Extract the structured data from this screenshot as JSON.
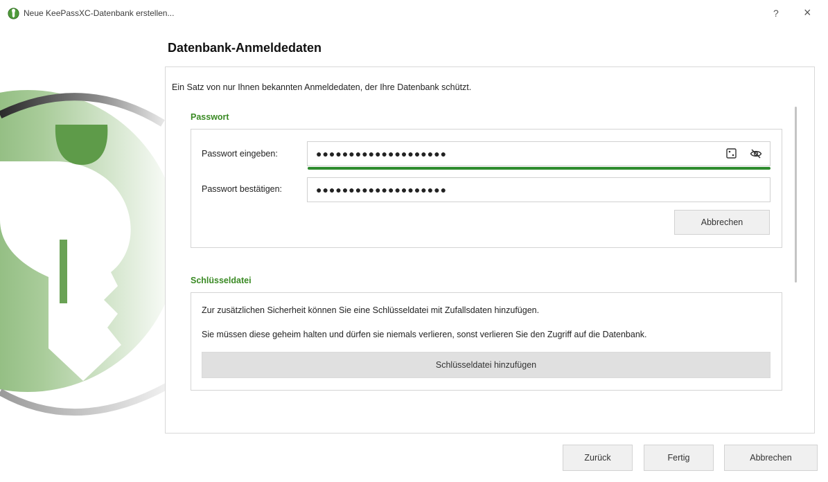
{
  "window": {
    "title": "Neue KeePassXC-Datenbank erstellen...",
    "help_label": "?",
    "close_label": "×"
  },
  "page": {
    "title": "Datenbank-Anmeldedaten",
    "intro": "Ein Satz von nur Ihnen bekannten Anmeldedaten, der Ihre Datenbank schützt."
  },
  "password": {
    "section_title": "Passwort",
    "enter_label": "Passwort eingeben:",
    "enter_value": "●●●●●●●●●●●●●●●●●●●●",
    "confirm_label": "Passwort bestätigen:",
    "confirm_value": "●●●●●●●●●●●●●●●●●●●●",
    "strength_fraction": 1.0,
    "cancel_label": "Abbrechen",
    "icons": [
      "password-generator-icon",
      "toggle-visibility-icon"
    ]
  },
  "keyfile": {
    "section_title": "Schlüsseldatei",
    "text1": "Zur zusätzlichen Sicherheit können Sie eine Schlüsseldatei mit Zufallsdaten hinzufügen.",
    "text2": "Sie müssen diese geheim halten und dürfen sie niemals verlieren, sonst verlieren Sie den Zugriff auf die Datenbank.",
    "add_label": "Schlüsseldatei hinzufügen"
  },
  "footer": {
    "back_label": "Zurück",
    "finish_label": "Fertig",
    "cancel_label": "Abbrechen"
  },
  "colors": {
    "accent_green": "#3a8a24",
    "strength_green": "#2e8b2e"
  }
}
